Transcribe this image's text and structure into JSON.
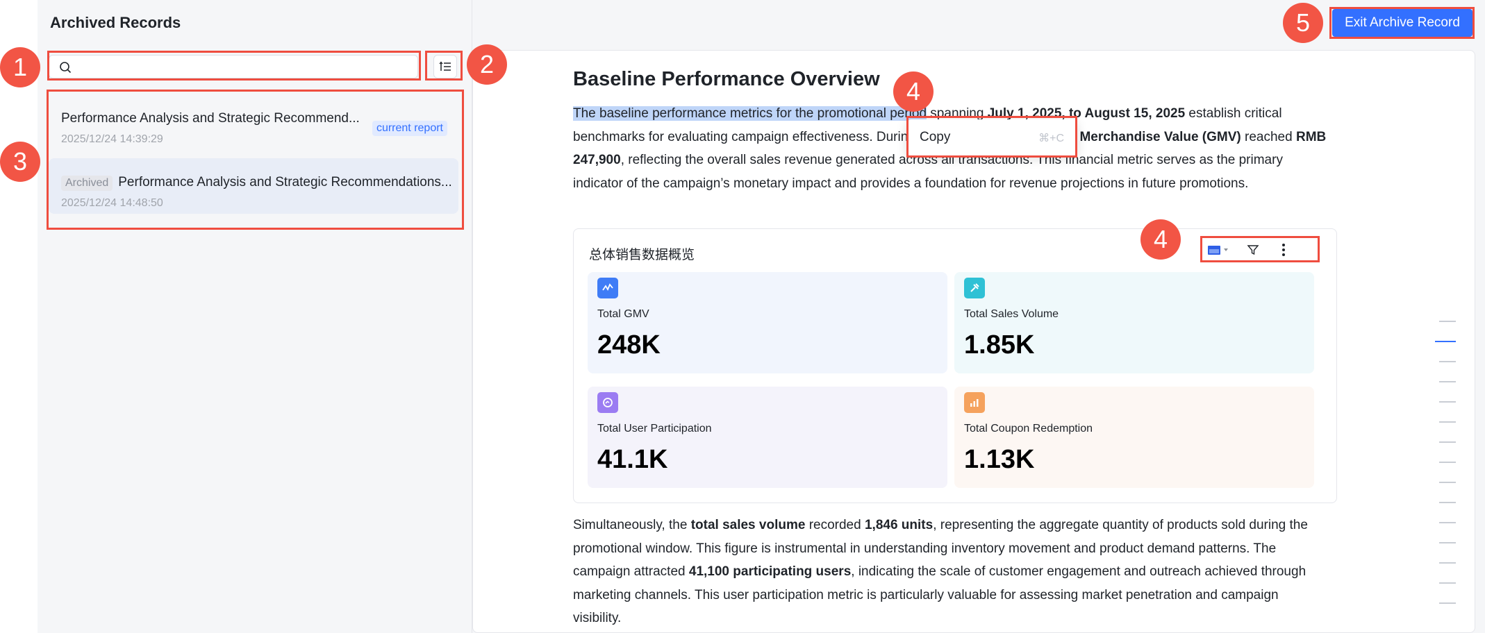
{
  "sidebar": {
    "title": "Archived Records",
    "search_placeholder": "",
    "records": [
      {
        "title": "Performance Analysis and Strategic Recommend...",
        "time": "2025/12/24 14:39:29",
        "badge": "current report"
      },
      {
        "title": "Performance Analysis and Strategic Recommendations...",
        "time": "2025/12/24 14:48:50",
        "tag": "Archived"
      }
    ]
  },
  "toolbar": {
    "exit_label": "Exit Archive Record"
  },
  "doc": {
    "title": "Baseline Performance Overview",
    "p1": {
      "highlighted": "The baseline performance metrics for the promotional period",
      "t1": " spanning ",
      "b1": "July 1, 2025, to August 15, 2025",
      "t2": " establish critical benchmarks for evaluating campaign effectiveness. During this period, the total ",
      "b2": "Gross Merchandise Value (GMV)",
      "t3": " reached ",
      "b3": "RMB 247,900",
      "t4": ", reflecting the overall sales revenue generated across all transactions. This financial metric serves as the primary indicator of the campaign’s monetary impact and provides a foundation for revenue projections in future promotions."
    },
    "p2": {
      "t1": "Simultaneously, the ",
      "b1": "total sales volume",
      "t2": " recorded ",
      "b2": "1,846 units",
      "t3": ", representing the aggregate quantity of products sold during the promotional window. This figure is instrumental in understanding inventory movement and product demand patterns. The campaign attracted ",
      "b3": "41,100 participating users",
      "t4": ", indicating the scale of customer engagement and outreach achieved through marketing channels. This user participation metric is particularly valuable for assessing market penetration and campaign visibility."
    }
  },
  "context_menu": {
    "label": "Copy",
    "shortcut": "⌘+C"
  },
  "card": {
    "title": "总体销售数据概览",
    "metrics": [
      {
        "label": "Total GMV",
        "value": "248K",
        "icon": "gmv-chart-icon",
        "color": "#3f7cf6",
        "bg": "#f1f5fd"
      },
      {
        "label": "Total Sales Volume",
        "value": "1.85K",
        "icon": "sales-volume-icon",
        "color": "#2fc1d5",
        "bg": "#eff9fb"
      },
      {
        "label": "Total User Participation",
        "value": "41.1K",
        "icon": "user-participation-icon",
        "color": "#9b7cf2",
        "bg": "#f4f3fb"
      },
      {
        "label": "Total Coupon Redemption",
        "value": "1.13K",
        "icon": "coupon-chart-icon",
        "color": "#f5a25d",
        "bg": "#fdf7f3"
      }
    ]
  },
  "annotations": [
    "1",
    "2",
    "3",
    "4",
    "4",
    "5"
  ],
  "colors": {
    "accent": "#3370ff",
    "annotation": "#f25545",
    "highlight": "#bfd5f8"
  }
}
